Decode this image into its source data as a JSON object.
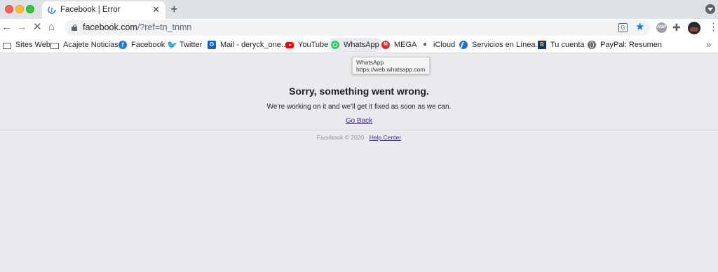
{
  "tab": {
    "title": "Facebook | Error",
    "close_label": "✕",
    "new_tab_label": "+"
  },
  "toolbar": {
    "url_host": "facebook.com",
    "url_path": "/?ref=tn_tnmn",
    "back_label": "←",
    "forward_label": "→",
    "stop_label": "✕",
    "home_label": "⌂",
    "abp_label": "ABP"
  },
  "bookmarks": [
    {
      "label": "Sites Web",
      "icon": "folder-icon"
    },
    {
      "label": "Acajete Noticias",
      "icon": "folder-icon"
    },
    {
      "label": "Facebook",
      "icon": "facebook-icon"
    },
    {
      "label": "Twitter",
      "icon": "twitter-icon"
    },
    {
      "label": "Mail - deryck_one...",
      "icon": "outlook-mail-icon"
    },
    {
      "label": "YouTube",
      "icon": "youtube-icon"
    },
    {
      "label": "WhatsApp",
      "icon": "whatsapp-icon"
    },
    {
      "label": "MEGA",
      "icon": "mega-icon"
    },
    {
      "label": "iCloud",
      "icon": "apple-icon"
    },
    {
      "label": "Servicios en Línea...",
      "icon": "services-icon"
    },
    {
      "label": "Tu cuenta",
      "icon": "bank-icon"
    },
    {
      "label": "PayPal: Resumen",
      "icon": "globe-icon"
    }
  ],
  "bookmarks_more_label": "»",
  "tooltip": {
    "title": "WhatsApp",
    "url": "https://web.whatsapp.com"
  },
  "page": {
    "error_title": "Sorry, something went wrong.",
    "error_message": "We're working on it and we'll get it fixed as soon as we can.",
    "go_back": "Go Back",
    "footer_copyright": "Facebook © 2020 · ",
    "help_center": "Help Center"
  },
  "colors": {
    "page_background": "#e9eaed",
    "link": "#3b2f8a",
    "star": "#1a73e8"
  }
}
